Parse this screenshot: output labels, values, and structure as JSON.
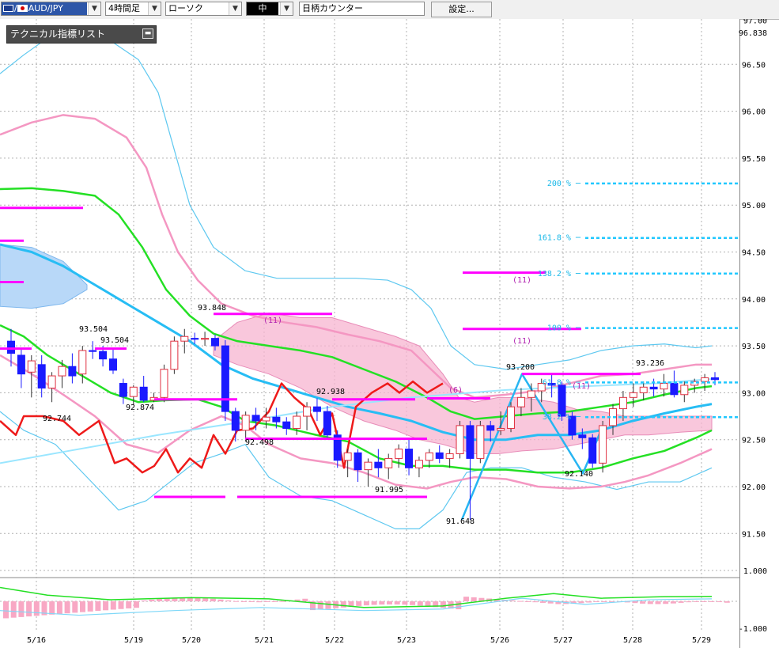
{
  "toolbar": {
    "pair": "AUD/JPY",
    "pair_prefix": "/",
    "timeframe": "4時間足",
    "chart_type": "ローソク",
    "candle_size": "中",
    "counter": "日柄カウンター",
    "settings": "設定..."
  },
  "indicator_list": {
    "label": "テクニカル指標リスト"
  },
  "colors": {
    "bull_candle": "#e03040",
    "bear_candle": "#1a1aff",
    "magenta": "#ff00ff",
    "cyan_dotted": "#20c8ff",
    "kumo": "#f7b4d0"
  },
  "chart_data": {
    "type": "candlestick",
    "symbol": "AUD/JPY",
    "price_axis": {
      "ticks": [
        "97.00",
        "96.838",
        "96.50",
        "96.00",
        "95.50",
        "95.00",
        "94.50",
        "94.00",
        "93.50",
        "93.00",
        "92.50",
        "92.00",
        "91.50"
      ],
      "ylim": [
        91.3,
        97.0
      ]
    },
    "oscillator_axis": {
      "ticks": [
        "1.000",
        "-1.000"
      ],
      "ylim": [
        -1.0,
        1.0
      ]
    },
    "x_ticks": [
      "5/16",
      "5/19",
      "5/20",
      "5/21",
      "5/22",
      "5/23",
      "5/26",
      "5/27",
      "5/28",
      "5/29"
    ],
    "candles": [
      [
        93.55,
        93.68,
        93.28,
        93.42
      ],
      [
        93.4,
        93.48,
        93.05,
        93.2
      ],
      [
        93.22,
        93.4,
        92.95,
        93.34
      ],
      [
        93.3,
        93.4,
        92.95,
        93.05
      ],
      [
        93.05,
        93.22,
        92.9,
        93.18
      ],
      [
        93.18,
        93.35,
        93.05,
        93.28
      ],
      [
        93.28,
        93.42,
        93.1,
        93.18
      ],
      [
        93.2,
        93.5,
        93.1,
        93.45
      ],
      [
        93.45,
        93.55,
        93.36,
        93.44
      ],
      [
        93.44,
        93.5,
        93.28,
        93.36
      ],
      [
        93.36,
        93.46,
        93.2,
        93.24
      ],
      [
        93.1,
        93.15,
        92.88,
        92.96
      ],
      [
        92.96,
        93.08,
        92.87,
        93.06
      ],
      [
        93.06,
        93.18,
        92.9,
        92.92
      ],
      [
        92.92,
        93.0,
        92.9,
        92.95
      ],
      [
        92.95,
        93.3,
        92.9,
        93.25
      ],
      [
        93.25,
        93.6,
        93.2,
        93.55
      ],
      [
        93.55,
        93.68,
        93.42,
        93.6
      ],
      [
        93.58,
        93.64,
        93.52,
        93.57
      ],
      [
        93.57,
        93.65,
        93.5,
        93.58
      ],
      [
        93.58,
        93.62,
        93.45,
        93.5
      ],
      [
        93.5,
        93.56,
        92.7,
        92.8
      ],
      [
        92.8,
        92.84,
        92.48,
        92.6
      ],
      [
        92.6,
        92.8,
        92.48,
        92.76
      ],
      [
        92.76,
        92.84,
        92.6,
        92.7
      ],
      [
        92.7,
        92.84,
        92.62,
        92.74
      ],
      [
        92.74,
        92.84,
        92.62,
        92.69
      ],
      [
        92.69,
        92.74,
        92.55,
        92.62
      ],
      [
        92.62,
        92.8,
        92.55,
        92.75
      ],
      [
        92.75,
        92.9,
        92.6,
        92.85
      ],
      [
        92.85,
        92.94,
        92.7,
        92.8
      ],
      [
        92.8,
        92.86,
        92.5,
        92.55
      ],
      [
        92.55,
        92.6,
        92.2,
        92.28
      ],
      [
        92.28,
        92.4,
        92.1,
        92.36
      ],
      [
        92.36,
        92.4,
        92.05,
        92.18
      ],
      [
        92.18,
        92.3,
        92.0,
        92.26
      ],
      [
        92.26,
        92.4,
        92.1,
        92.2
      ],
      [
        92.2,
        92.35,
        92.08,
        92.3
      ],
      [
        92.3,
        92.45,
        92.2,
        92.4
      ],
      [
        92.4,
        92.5,
        92.12,
        92.2
      ],
      [
        92.2,
        92.32,
        92.1,
        92.28
      ],
      [
        92.28,
        92.4,
        92.2,
        92.36
      ],
      [
        92.36,
        92.44,
        92.25,
        92.3
      ],
      [
        92.3,
        92.4,
        92.2,
        92.35
      ],
      [
        92.35,
        92.7,
        92.3,
        92.65
      ],
      [
        92.65,
        92.7,
        91.648,
        92.3
      ],
      [
        92.3,
        92.7,
        92.25,
        92.65
      ],
      [
        92.65,
        92.7,
        92.48,
        92.6
      ],
      [
        92.6,
        92.8,
        92.55,
        92.62
      ],
      [
        92.62,
        92.9,
        92.58,
        92.85
      ],
      [
        92.85,
        93.05,
        92.75,
        92.95
      ],
      [
        92.95,
        93.1,
        92.8,
        93.02
      ],
      [
        93.02,
        93.15,
        92.9,
        93.1
      ],
      [
        93.1,
        93.2,
        92.95,
        93.08
      ],
      [
        93.08,
        93.12,
        92.7,
        92.75
      ],
      [
        92.75,
        92.8,
        92.5,
        92.55
      ],
      [
        92.55,
        92.62,
        92.4,
        92.52
      ],
      [
        92.52,
        92.56,
        92.2,
        92.25
      ],
      [
        92.25,
        92.7,
        92.15,
        92.65
      ],
      [
        92.65,
        92.88,
        92.55,
        92.83
      ],
      [
        92.83,
        93.02,
        92.7,
        92.95
      ],
      [
        92.95,
        93.1,
        92.85,
        93.0
      ],
      [
        93.0,
        93.12,
        92.92,
        93.06
      ],
      [
        93.06,
        93.15,
        92.96,
        93.04
      ],
      [
        93.04,
        93.2,
        92.96,
        93.1
      ],
      [
        93.1,
        93.236,
        92.95,
        92.98
      ],
      [
        92.98,
        93.12,
        92.9,
        93.08
      ],
      [
        93.08,
        93.15,
        93.0,
        93.12
      ],
      [
        93.12,
        93.2,
        93.02,
        93.16
      ],
      [
        93.16,
        93.22,
        93.08,
        93.14
      ]
    ],
    "price_labels": [
      "93.504",
      "93.504",
      "92.744",
      "92.874",
      "93.848",
      "92.498",
      "92.938",
      "91.995",
      "91.648",
      "93.200",
      "92.140",
      "93.236"
    ],
    "fib_levels": [
      {
        "label": "200 %",
        "price": 95.23
      },
      {
        "label": "161.8 %",
        "price": 94.65
      },
      {
        "label": "138.2 %",
        "price": 94.27
      },
      {
        "label": "100 %",
        "price": 93.69
      },
      {
        "label": "61.8 %",
        "price": 93.11
      },
      {
        "label": "38.2 %",
        "price": 92.74
      }
    ],
    "count_labels": [
      "(11)",
      "(11)",
      "(11)",
      "(11)",
      "(6)"
    ]
  }
}
